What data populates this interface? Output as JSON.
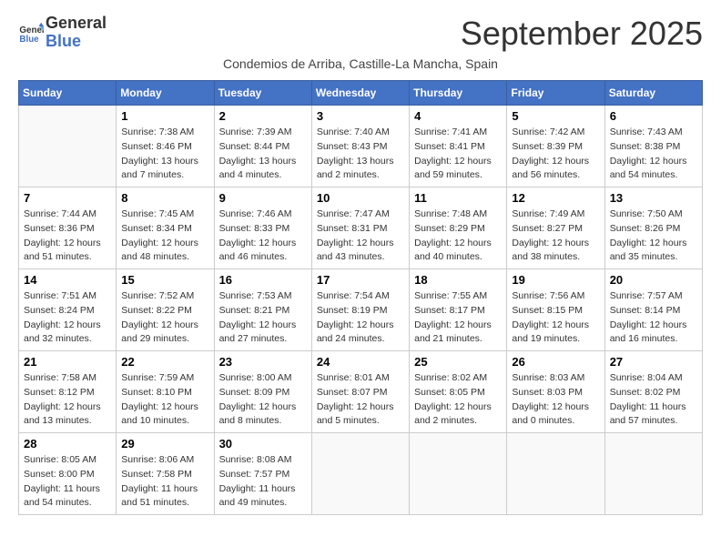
{
  "header": {
    "logo_line1": "General",
    "logo_line2": "Blue",
    "month": "September 2025",
    "location": "Condemios de Arriba, Castille-La Mancha, Spain"
  },
  "days_of_week": [
    "Sunday",
    "Monday",
    "Tuesday",
    "Wednesday",
    "Thursday",
    "Friday",
    "Saturday"
  ],
  "weeks": [
    [
      {
        "day": "",
        "sunrise": "",
        "sunset": "",
        "daylight": ""
      },
      {
        "day": "1",
        "sunrise": "Sunrise: 7:38 AM",
        "sunset": "Sunset: 8:46 PM",
        "daylight": "Daylight: 13 hours and 7 minutes."
      },
      {
        "day": "2",
        "sunrise": "Sunrise: 7:39 AM",
        "sunset": "Sunset: 8:44 PM",
        "daylight": "Daylight: 13 hours and 4 minutes."
      },
      {
        "day": "3",
        "sunrise": "Sunrise: 7:40 AM",
        "sunset": "Sunset: 8:43 PM",
        "daylight": "Daylight: 13 hours and 2 minutes."
      },
      {
        "day": "4",
        "sunrise": "Sunrise: 7:41 AM",
        "sunset": "Sunset: 8:41 PM",
        "daylight": "Daylight: 12 hours and 59 minutes."
      },
      {
        "day": "5",
        "sunrise": "Sunrise: 7:42 AM",
        "sunset": "Sunset: 8:39 PM",
        "daylight": "Daylight: 12 hours and 56 minutes."
      },
      {
        "day": "6",
        "sunrise": "Sunrise: 7:43 AM",
        "sunset": "Sunset: 8:38 PM",
        "daylight": "Daylight: 12 hours and 54 minutes."
      }
    ],
    [
      {
        "day": "7",
        "sunrise": "Sunrise: 7:44 AM",
        "sunset": "Sunset: 8:36 PM",
        "daylight": "Daylight: 12 hours and 51 minutes."
      },
      {
        "day": "8",
        "sunrise": "Sunrise: 7:45 AM",
        "sunset": "Sunset: 8:34 PM",
        "daylight": "Daylight: 12 hours and 48 minutes."
      },
      {
        "day": "9",
        "sunrise": "Sunrise: 7:46 AM",
        "sunset": "Sunset: 8:33 PM",
        "daylight": "Daylight: 12 hours and 46 minutes."
      },
      {
        "day": "10",
        "sunrise": "Sunrise: 7:47 AM",
        "sunset": "Sunset: 8:31 PM",
        "daylight": "Daylight: 12 hours and 43 minutes."
      },
      {
        "day": "11",
        "sunrise": "Sunrise: 7:48 AM",
        "sunset": "Sunset: 8:29 PM",
        "daylight": "Daylight: 12 hours and 40 minutes."
      },
      {
        "day": "12",
        "sunrise": "Sunrise: 7:49 AM",
        "sunset": "Sunset: 8:27 PM",
        "daylight": "Daylight: 12 hours and 38 minutes."
      },
      {
        "day": "13",
        "sunrise": "Sunrise: 7:50 AM",
        "sunset": "Sunset: 8:26 PM",
        "daylight": "Daylight: 12 hours and 35 minutes."
      }
    ],
    [
      {
        "day": "14",
        "sunrise": "Sunrise: 7:51 AM",
        "sunset": "Sunset: 8:24 PM",
        "daylight": "Daylight: 12 hours and 32 minutes."
      },
      {
        "day": "15",
        "sunrise": "Sunrise: 7:52 AM",
        "sunset": "Sunset: 8:22 PM",
        "daylight": "Daylight: 12 hours and 29 minutes."
      },
      {
        "day": "16",
        "sunrise": "Sunrise: 7:53 AM",
        "sunset": "Sunset: 8:21 PM",
        "daylight": "Daylight: 12 hours and 27 minutes."
      },
      {
        "day": "17",
        "sunrise": "Sunrise: 7:54 AM",
        "sunset": "Sunset: 8:19 PM",
        "daylight": "Daylight: 12 hours and 24 minutes."
      },
      {
        "day": "18",
        "sunrise": "Sunrise: 7:55 AM",
        "sunset": "Sunset: 8:17 PM",
        "daylight": "Daylight: 12 hours and 21 minutes."
      },
      {
        "day": "19",
        "sunrise": "Sunrise: 7:56 AM",
        "sunset": "Sunset: 8:15 PM",
        "daylight": "Daylight: 12 hours and 19 minutes."
      },
      {
        "day": "20",
        "sunrise": "Sunrise: 7:57 AM",
        "sunset": "Sunset: 8:14 PM",
        "daylight": "Daylight: 12 hours and 16 minutes."
      }
    ],
    [
      {
        "day": "21",
        "sunrise": "Sunrise: 7:58 AM",
        "sunset": "Sunset: 8:12 PM",
        "daylight": "Daylight: 12 hours and 13 minutes."
      },
      {
        "day": "22",
        "sunrise": "Sunrise: 7:59 AM",
        "sunset": "Sunset: 8:10 PM",
        "daylight": "Daylight: 12 hours and 10 minutes."
      },
      {
        "day": "23",
        "sunrise": "Sunrise: 8:00 AM",
        "sunset": "Sunset: 8:09 PM",
        "daylight": "Daylight: 12 hours and 8 minutes."
      },
      {
        "day": "24",
        "sunrise": "Sunrise: 8:01 AM",
        "sunset": "Sunset: 8:07 PM",
        "daylight": "Daylight: 12 hours and 5 minutes."
      },
      {
        "day": "25",
        "sunrise": "Sunrise: 8:02 AM",
        "sunset": "Sunset: 8:05 PM",
        "daylight": "Daylight: 12 hours and 2 minutes."
      },
      {
        "day": "26",
        "sunrise": "Sunrise: 8:03 AM",
        "sunset": "Sunset: 8:03 PM",
        "daylight": "Daylight: 12 hours and 0 minutes."
      },
      {
        "day": "27",
        "sunrise": "Sunrise: 8:04 AM",
        "sunset": "Sunset: 8:02 PM",
        "daylight": "Daylight: 11 hours and 57 minutes."
      }
    ],
    [
      {
        "day": "28",
        "sunrise": "Sunrise: 8:05 AM",
        "sunset": "Sunset: 8:00 PM",
        "daylight": "Daylight: 11 hours and 54 minutes."
      },
      {
        "day": "29",
        "sunrise": "Sunrise: 8:06 AM",
        "sunset": "Sunset: 7:58 PM",
        "daylight": "Daylight: 11 hours and 51 minutes."
      },
      {
        "day": "30",
        "sunrise": "Sunrise: 8:08 AM",
        "sunset": "Sunset: 7:57 PM",
        "daylight": "Daylight: 11 hours and 49 minutes."
      },
      {
        "day": "",
        "sunrise": "",
        "sunset": "",
        "daylight": ""
      },
      {
        "day": "",
        "sunrise": "",
        "sunset": "",
        "daylight": ""
      },
      {
        "day": "",
        "sunrise": "",
        "sunset": "",
        "daylight": ""
      },
      {
        "day": "",
        "sunrise": "",
        "sunset": "",
        "daylight": ""
      }
    ]
  ]
}
